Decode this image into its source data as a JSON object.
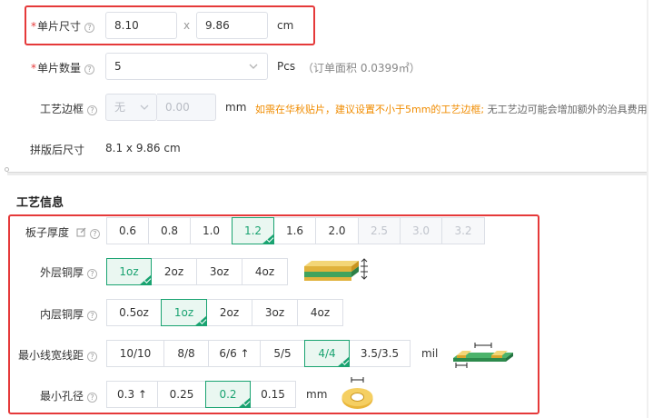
{
  "size": {
    "label": "单片尺寸",
    "width": "8.10",
    "x_sep": "x",
    "height": "9.86",
    "unit": "cm"
  },
  "qty": {
    "label": "单片数量",
    "value": "5",
    "unit": "Pcs",
    "area_note": "（订单面积 0.0399㎡）"
  },
  "frame": {
    "label": "工艺边框",
    "select_value": "无",
    "input_value": "0.00",
    "unit": "mm",
    "note_orange": "如需在华秋贴片，建议设置不小于5mm的工艺边框;",
    "note_gray": " 无工艺边可能会增加额外的治具费用"
  },
  "panel": {
    "label": "拼版后尺寸",
    "value": "8.1 x 9.86 cm"
  },
  "section_title": "工艺信息",
  "thickness": {
    "label": "板子厚度",
    "options": [
      "0.6",
      "0.8",
      "1.0",
      "1.2",
      "1.6",
      "2.0",
      "2.5",
      "3.0",
      "3.2"
    ],
    "selected": "1.2"
  },
  "outer_copper": {
    "label": "外层铜厚",
    "options": [
      "1oz",
      "2oz",
      "3oz",
      "4oz"
    ],
    "selected": "1oz"
  },
  "inner_copper": {
    "label": "内层铜厚",
    "options": [
      "0.5oz",
      "1oz",
      "2oz",
      "3oz",
      "4oz"
    ],
    "selected": "1oz"
  },
  "trace": {
    "label": "最小线宽线距",
    "options": [
      "10/10",
      "8/8",
      "6/6 ↑",
      "5/5",
      "4/4",
      "3.5/3.5"
    ],
    "selected": "4/4",
    "unit": "mil"
  },
  "hole": {
    "label": "最小孔径",
    "options": [
      "0.3 ↑",
      "0.25",
      "0.2",
      "0.15"
    ],
    "selected": "0.2",
    "unit": "mm"
  },
  "colors": {
    "accent": "#1aa371",
    "required": "#e5393a",
    "warning": "#f08c00",
    "highlight_box": "#e5393a"
  },
  "icons": [
    "help-icon",
    "edit-icon",
    "chevron-down-icon",
    "layer-thickness-icon",
    "trace-spacing-icon",
    "hole-ring-icon"
  ]
}
